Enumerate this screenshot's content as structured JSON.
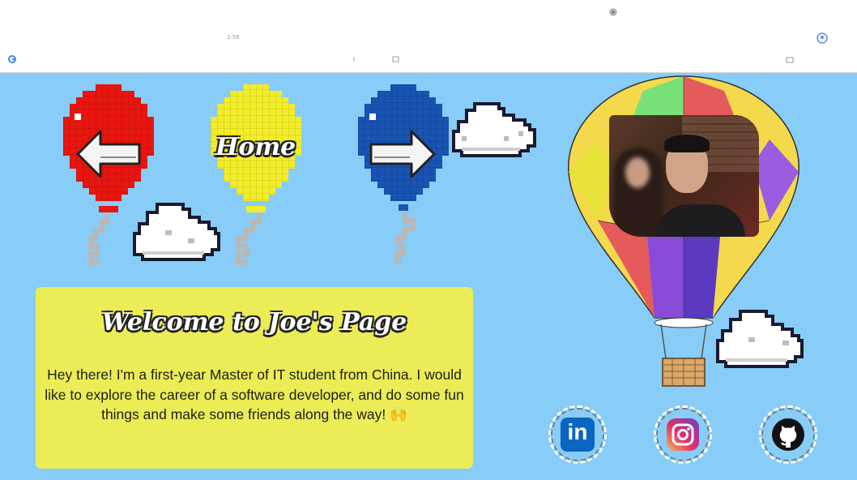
{
  "browser": {
    "small_text": "1:58",
    "icons": [
      "google-icon",
      "camera-icon",
      "record-icon",
      "folder-icon",
      "profile-icon",
      "settings-icon"
    ]
  },
  "nav": {
    "back_icon": "left-arrow-icon",
    "home_label": "Home",
    "forward_icon": "right-arrow-icon"
  },
  "welcome": {
    "title": "Welcome to Joe's Page",
    "body": "Hey there! I'm a first-year Master of IT student from China. I would like to explore the career of a software developer, and do some fun things and make some friends along the way! 🙌"
  },
  "social": [
    {
      "name": "linkedin",
      "icon": "linkedin-icon",
      "label": "in"
    },
    {
      "name": "instagram",
      "icon": "instagram-icon"
    },
    {
      "name": "github",
      "icon": "github-icon"
    }
  ],
  "colors": {
    "sky": "#87cdf7",
    "card": "#ecec56",
    "red_balloon": "#e8160f",
    "yellow_balloon": "#f2ec2b",
    "blue_balloon": "#1954b3",
    "linkedin": "#0a66c2"
  }
}
